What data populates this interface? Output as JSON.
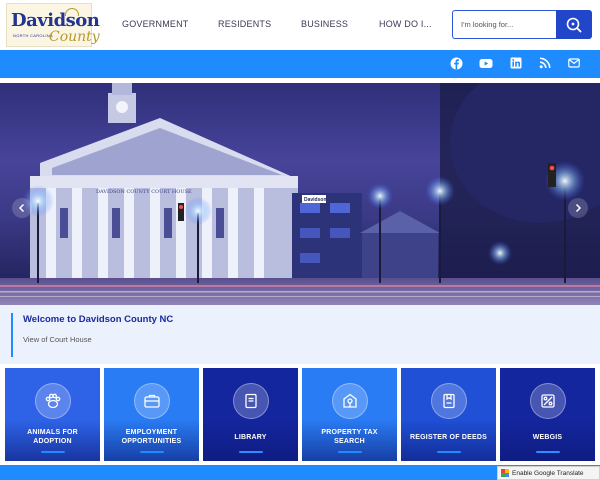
{
  "logo": {
    "main": "Davidson",
    "state": "NORTH CAROLINA",
    "script": "County"
  },
  "nav": [
    {
      "label": "GOVERNMENT"
    },
    {
      "label": "RESIDENTS"
    },
    {
      "label": "BUSINESS"
    },
    {
      "label": "HOW DO I..."
    }
  ],
  "search": {
    "placeholder": "I'm looking for..."
  },
  "social": [
    "facebook-icon",
    "youtube-icon",
    "linkedin-icon",
    "rss-icon",
    "email-icon"
  ],
  "hero": {
    "building_sign": "DAVIDSON COUNTY COURT HOUSE",
    "side_sign": "Davidson",
    "colors": {
      "sky": "#47449a",
      "building": "#cfd2e6",
      "lights": "#e8f4ff"
    }
  },
  "caption": {
    "title": "Welcome to Davidson County NC",
    "subtitle": "View of Court House"
  },
  "tiles": [
    {
      "label": "ANIMALS FOR ADOPTION",
      "icon": "paw-icon",
      "color": "#2e63e8"
    },
    {
      "label": "EMPLOYMENT OPPORTUNITIES",
      "icon": "briefcase-icon",
      "color": "#2a7cf4"
    },
    {
      "label": "LIBRARY",
      "icon": "book-icon",
      "color": "#14269e"
    },
    {
      "label": "PROPERTY TAX SEARCH",
      "icon": "house-icon",
      "color": "#2a7cf4"
    },
    {
      "label": "REGISTER OF DEEDS",
      "icon": "document-icon",
      "color": "#1f50d6"
    },
    {
      "label": "WEBGIS",
      "icon": "map-icon",
      "color": "#14269e"
    }
  ],
  "translate": {
    "label": "Enable Google Translate"
  }
}
